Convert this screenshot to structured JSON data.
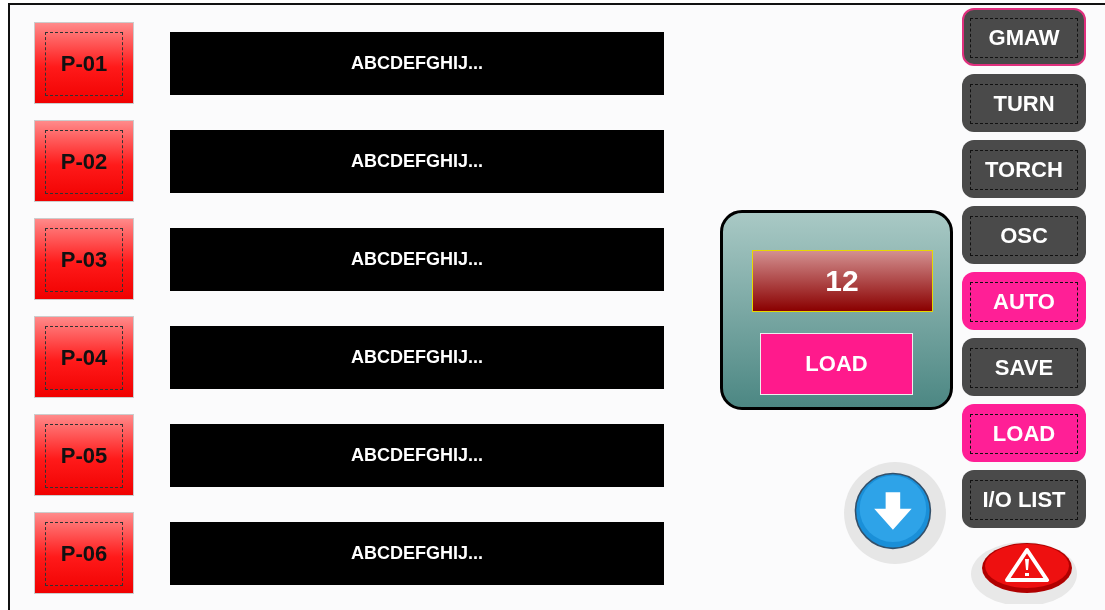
{
  "programs": [
    {
      "label": "P-01",
      "name": "ABCDEFGHIJ..."
    },
    {
      "label": "P-02",
      "name": "ABCDEFGHIJ..."
    },
    {
      "label": "P-03",
      "name": "ABCDEFGHIJ..."
    },
    {
      "label": "P-04",
      "name": "ABCDEFGHIJ..."
    },
    {
      "label": "P-05",
      "name": "ABCDEFGHIJ..."
    },
    {
      "label": "P-06",
      "name": "ABCDEFGHIJ..."
    }
  ],
  "load_panel": {
    "value": "12",
    "button": "LOAD"
  },
  "menu": [
    {
      "label": "GMAW",
      "color": "#4a4a4a",
      "selected": true
    },
    {
      "label": "TURN",
      "color": "#4a4a4a",
      "selected": false
    },
    {
      "label": "TORCH",
      "color": "#4a4a4a",
      "selected": false
    },
    {
      "label": "OSC",
      "color": "#4a4a4a",
      "selected": false
    },
    {
      "label": "AUTO",
      "color": "#ff1f96",
      "selected": false
    },
    {
      "label": "SAVE",
      "color": "#4a4a4a",
      "selected": false
    },
    {
      "label": "LOAD",
      "color": "#ff1f96",
      "selected": false
    },
    {
      "label": "I/O LIST",
      "color": "#4a4a4a",
      "selected": false
    }
  ]
}
